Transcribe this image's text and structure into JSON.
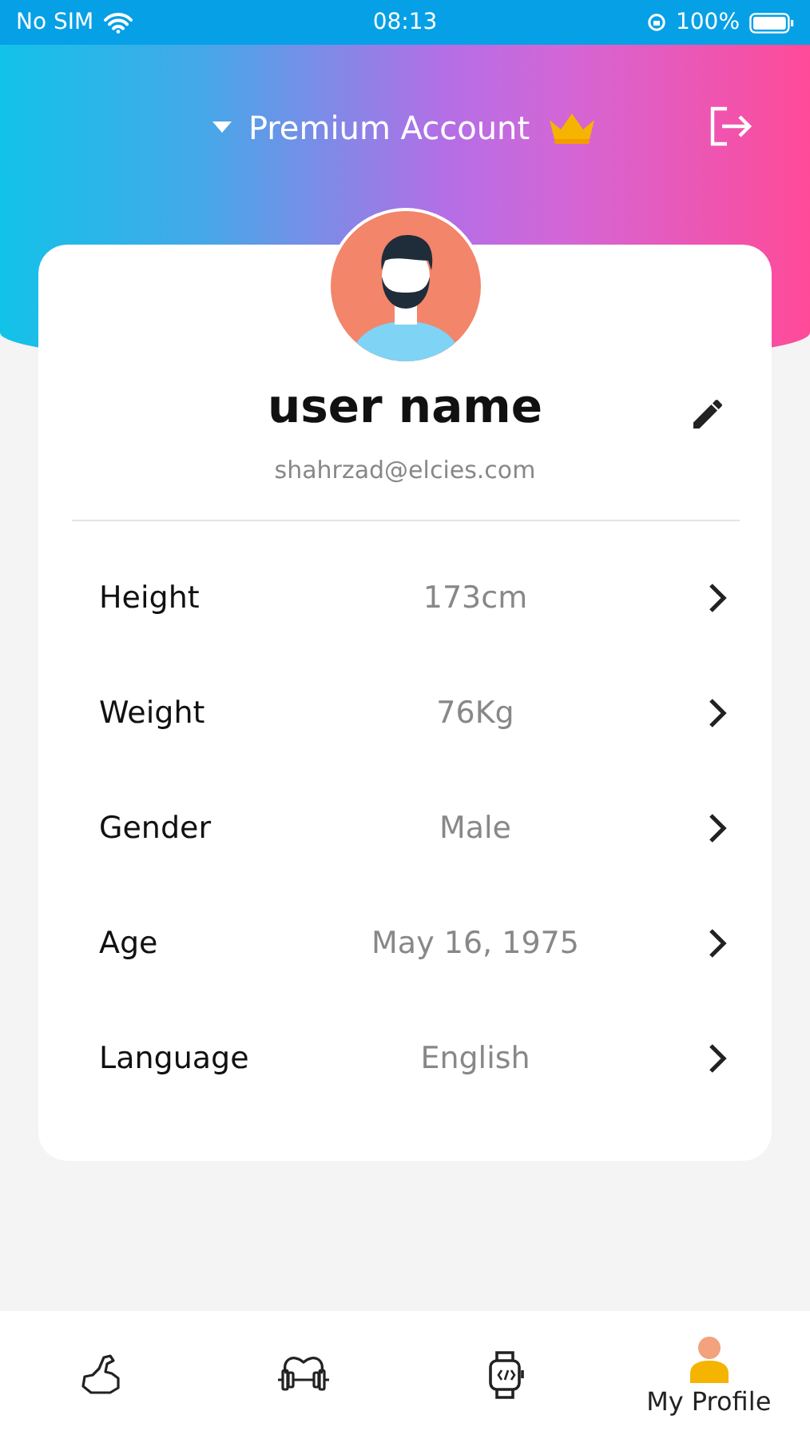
{
  "status_bar": {
    "carrier": "No SIM",
    "time": "08:13",
    "battery": "100%"
  },
  "header": {
    "account": "Premium Account"
  },
  "profile": {
    "name": "user name",
    "email": "shahrzad@elcies.com"
  },
  "fields": [
    {
      "label": "Height",
      "value": "173cm"
    },
    {
      "label": "Weight",
      "value": "76Kg"
    },
    {
      "label": "Gender",
      "value": "Male"
    },
    {
      "label": "Age",
      "value": "May 16, 1975"
    },
    {
      "label": "Language",
      "value": "English"
    }
  ],
  "tabs": [
    {
      "kind": "muscle",
      "selected": false
    },
    {
      "kind": "fitness",
      "selected": false
    },
    {
      "kind": "watch",
      "selected": false
    },
    {
      "kind": "profile",
      "label": "My Profile",
      "selected": true
    }
  ]
}
